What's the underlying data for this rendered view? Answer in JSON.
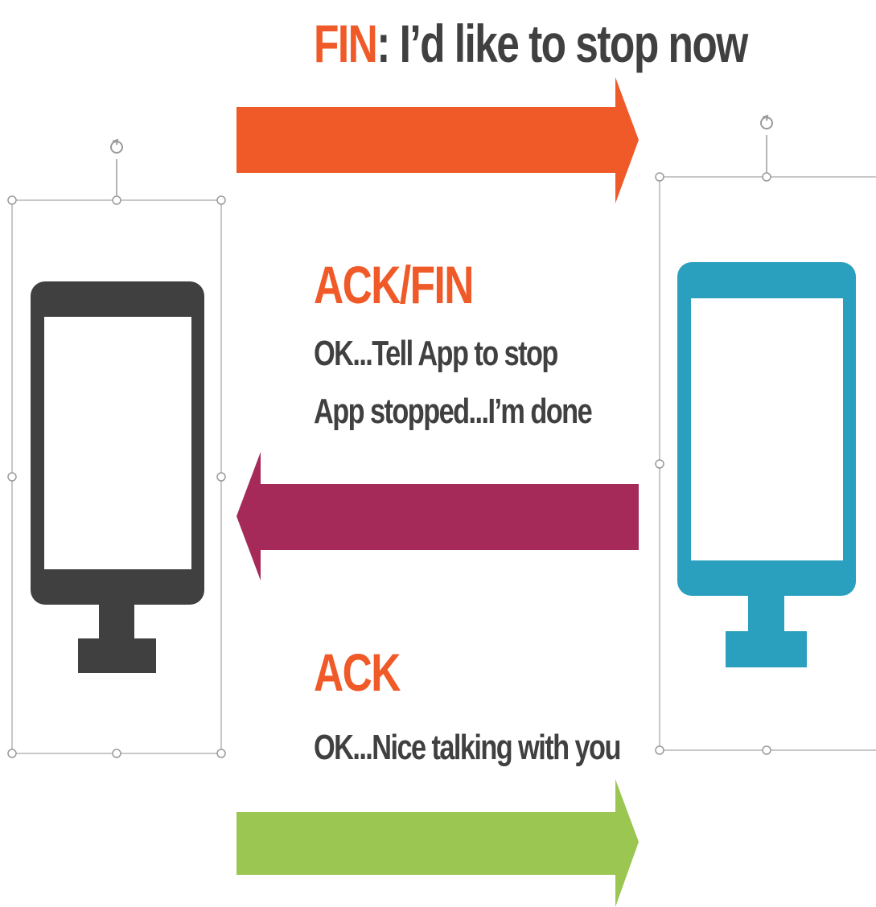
{
  "colors": {
    "orange": "#EF5A28",
    "maroon": "#A52A5A",
    "green": "#9BC651",
    "dark": "#404040",
    "teal": "#2BA0BE",
    "handle": "#9A9A9A"
  },
  "messages": [
    {
      "title": "FIN",
      "title_suffix": ": I’d like to stop now",
      "direction": "right",
      "color_key": "orange"
    },
    {
      "title": "ACK/FIN",
      "lines": [
        "OK...Tell App to stop",
        "App stopped...I’m done"
      ],
      "direction": "left",
      "color_key": "maroon"
    },
    {
      "title": "ACK",
      "lines": [
        "OK...Nice talking with you"
      ],
      "direction": "right",
      "color_key": "green"
    }
  ],
  "icons": {
    "left_computer": "monitor-icon",
    "right_computer": "monitor-icon",
    "rotate_handle": "rotate-icon"
  }
}
